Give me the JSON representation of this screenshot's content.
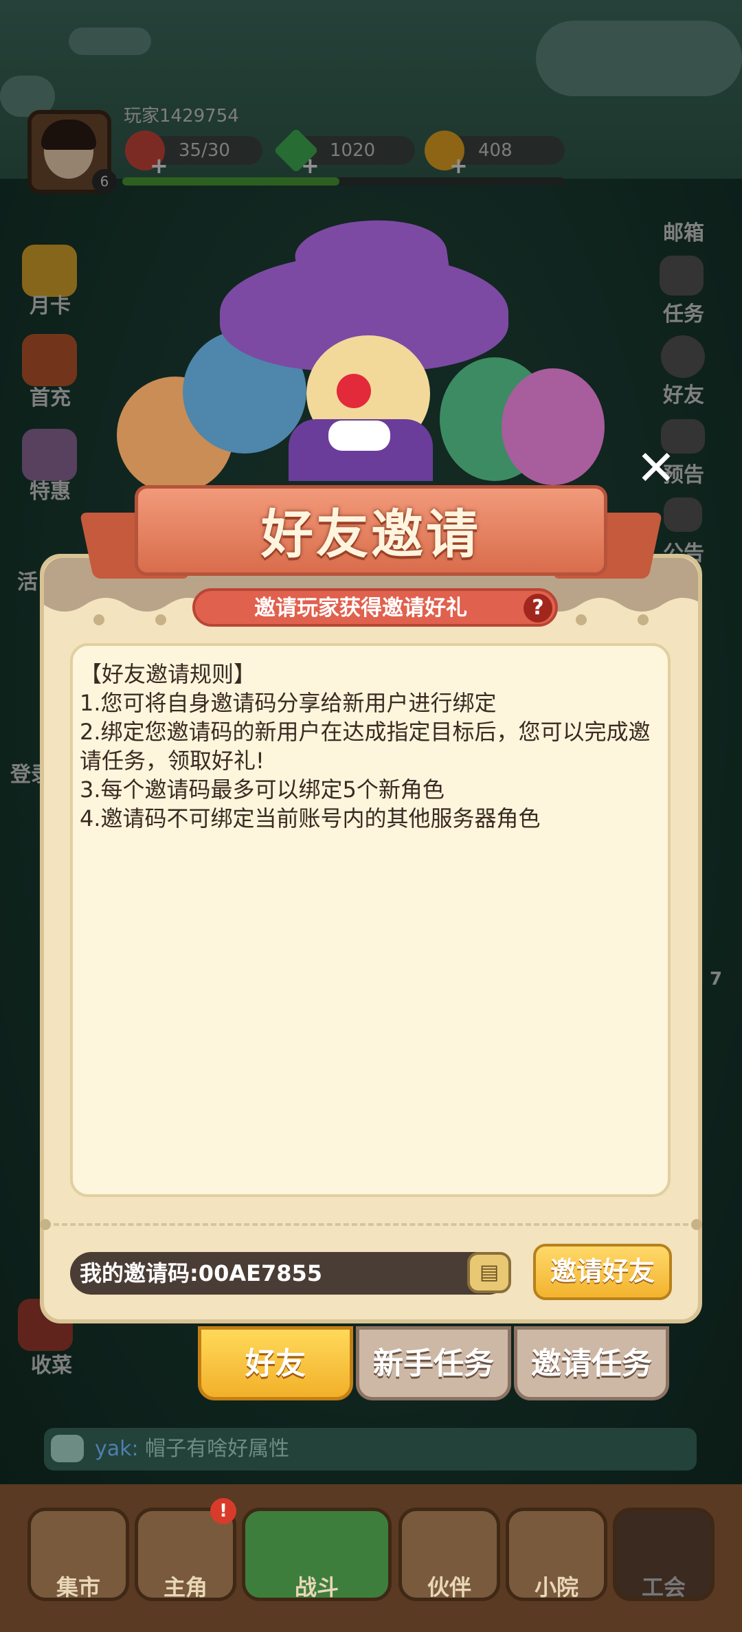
{
  "hud": {
    "player_name": "玩家1429754",
    "level": "6",
    "stamina": "35/30",
    "gems": "1020",
    "coins": "408",
    "xp_fraction": 0.49,
    "colors": {
      "stamina": "#c8463a",
      "gems": "#3fae52",
      "coins": "#e4a322"
    }
  },
  "left_menu": [
    "月卡",
    "首充",
    "特惠"
  ],
  "left_partial": {
    "item4": "活",
    "login": "登录"
  },
  "right_menu": [
    "邮箱",
    "任务",
    "好友",
    "预告",
    "公告"
  ],
  "right_partial": {
    "count": "7"
  },
  "bottom_left_label": "收菜",
  "modal": {
    "title": "好友邀请",
    "subtitle": "邀请玩家获得邀请好礼",
    "help": "?",
    "close": "✕",
    "rules": [
      "【好友邀请规则】",
      "1.您可将自身邀请码分享给新用户进行绑定",
      "2.绑定您邀请码的新用户在达成指定目标后，您可以完成邀请任务，领取好礼!",
      "3.每个邀请码最多可以绑定5个新角色",
      "4.邀请码不可绑定当前账号内的其他服务器角色"
    ],
    "invite_code_label": "我的邀请码:00AE7855",
    "invite_button": "邀请好友",
    "copy_icon": "copy-icon"
  },
  "tabs": [
    {
      "label": "好友",
      "active": true
    },
    {
      "label": "新手任务",
      "active": false
    },
    {
      "label": "邀请任务",
      "active": false
    }
  ],
  "chat": {
    "user": "yak:",
    "message": " 帽子有啥好属性"
  },
  "nav": {
    "items": [
      "集市",
      "主角",
      "战斗",
      "伙伴",
      "小院",
      "工会"
    ],
    "badge": "!"
  }
}
